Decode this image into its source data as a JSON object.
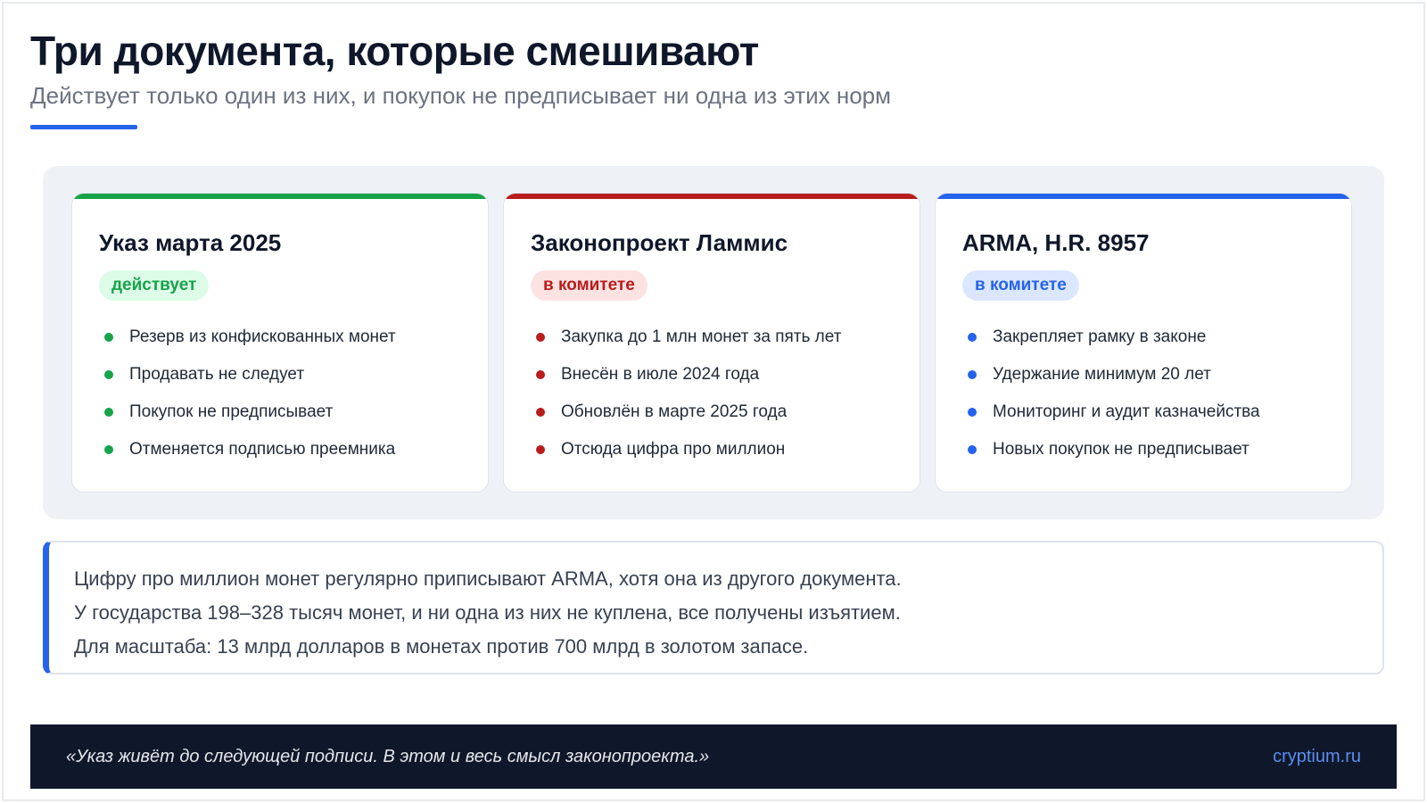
{
  "header": {
    "title": "Три документа, которые смешивают",
    "subtitle": "Действует только один из них, и покупок не предписывает ни одна из этих норм"
  },
  "colors": {
    "accent": "#2563eb",
    "green": "#16a34a",
    "red": "#b91c1c",
    "blue": "#2563eb"
  },
  "cards": [
    {
      "title": "Указ марта 2025",
      "badge": "действует",
      "items": [
        "Резерв из конфискованных монет",
        "Продавать не следует",
        "Покупок не предписывает",
        "Отменяется подписью преемника"
      ]
    },
    {
      "title": "Законопроект Ламмис",
      "badge": "в комитете",
      "items": [
        "Закупка до 1 млн монет за пять лет",
        "Внесён в июле 2024 года",
        "Обновлён в марте 2025 года",
        "Отсюда цифра про миллион"
      ]
    },
    {
      "title": "ARMA, H.R. 8957",
      "badge": "в комитете",
      "items": [
        "Закрепляет рамку в законе",
        "Удержание минимум 20 лет",
        "Мониторинг и аудит казначейства",
        "Новых покупок не предписывает"
      ]
    }
  ],
  "note": {
    "lines": [
      "Цифру про миллион монет регулярно приписывают ARMA, хотя она из другого документа.",
      "У государства 198–328 тысяч монет, и ни одна из них не куплена, все получены изъятием.",
      "Для масштаба: 13 млрд долларов в монетах против 700 млрд в золотом запасе."
    ]
  },
  "footer": {
    "quote": "«Указ живёт до следующей подписи. В этом и весь смысл законопроекта.»",
    "site": "cryptium.ru"
  }
}
